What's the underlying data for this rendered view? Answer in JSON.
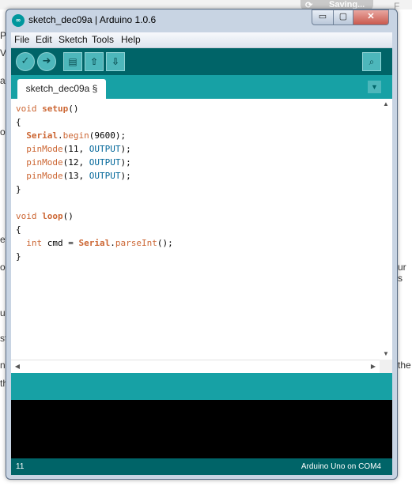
{
  "background": {
    "saving_label": "Saving...",
    "right_fragment": "F",
    "left_fragments": [
      "P",
      "V",
      "a",
      "o",
      "et",
      "o",
      "u",
      "st",
      "n",
      "th"
    ],
    "right_fragments": [
      "ur s",
      "the"
    ]
  },
  "window": {
    "title": "sketch_dec09a | Arduino 1.0.6",
    "icon_text": "∞",
    "controls": {
      "minimize": "▭",
      "maximize": "▢",
      "close": "✕"
    }
  },
  "menu": [
    "File",
    "Edit",
    "Sketch",
    "Tools",
    "Help"
  ],
  "toolbar": {
    "buttons": [
      {
        "name": "verify",
        "glyph": "✓"
      },
      {
        "name": "upload",
        "glyph": "➜"
      },
      {
        "name": "new",
        "glyph": "▤"
      },
      {
        "name": "open",
        "glyph": "⇧"
      },
      {
        "name": "save",
        "glyph": "⇩"
      }
    ],
    "search_glyph": "⌕"
  },
  "tab": {
    "label": "sketch_dec09a §",
    "menu_glyph": "▼"
  },
  "code_lines": [
    [
      {
        "t": "void ",
        "c": "kw"
      },
      {
        "t": "setup",
        "c": "kwb"
      },
      {
        "t": "()",
        "c": ""
      }
    ],
    [
      {
        "t": "{",
        "c": ""
      }
    ],
    [
      {
        "t": "  ",
        "c": ""
      },
      {
        "t": "Serial",
        "c": "kwb"
      },
      {
        "t": ".",
        "c": ""
      },
      {
        "t": "begin",
        "c": "kw"
      },
      {
        "t": "(9600);",
        "c": ""
      }
    ],
    [
      {
        "t": "  ",
        "c": ""
      },
      {
        "t": "pinMode",
        "c": "kw"
      },
      {
        "t": "(11, ",
        "c": ""
      },
      {
        "t": "OUTPUT",
        "c": "cn"
      },
      {
        "t": ");",
        "c": ""
      }
    ],
    [
      {
        "t": "  ",
        "c": ""
      },
      {
        "t": "pinMode",
        "c": "kw"
      },
      {
        "t": "(12, ",
        "c": ""
      },
      {
        "t": "OUTPUT",
        "c": "cn"
      },
      {
        "t": ");",
        "c": ""
      }
    ],
    [
      {
        "t": "  ",
        "c": ""
      },
      {
        "t": "pinMode",
        "c": "kw"
      },
      {
        "t": "(13, ",
        "c": ""
      },
      {
        "t": "OUTPUT",
        "c": "cn"
      },
      {
        "t": ");",
        "c": ""
      }
    ],
    [
      {
        "t": "}",
        "c": ""
      }
    ],
    [
      {
        "t": "",
        "c": ""
      }
    ],
    [
      {
        "t": "void ",
        "c": "kw"
      },
      {
        "t": "loop",
        "c": "kwb"
      },
      {
        "t": "()",
        "c": ""
      }
    ],
    [
      {
        "t": "{",
        "c": ""
      }
    ],
    [
      {
        "t": "  ",
        "c": ""
      },
      {
        "t": "int",
        "c": "kw"
      },
      {
        "t": " cmd = ",
        "c": ""
      },
      {
        "t": "Serial",
        "c": "kwb"
      },
      {
        "t": ".",
        "c": ""
      },
      {
        "t": "parseInt",
        "c": "kw"
      },
      {
        "t": "();",
        "c": ""
      }
    ],
    [
      {
        "t": "}",
        "c": ""
      }
    ]
  ],
  "scroll": {
    "up": "▲",
    "down": "▼",
    "left": "◀",
    "right": "▶"
  },
  "status": {
    "line": "11",
    "board": "Arduino Uno on COM4"
  },
  "colors": {
    "teal_dark": "#006468",
    "teal": "#00979d",
    "teal_light": "#17a1a5",
    "keyword": "#cc6633",
    "constant": "#006699"
  }
}
